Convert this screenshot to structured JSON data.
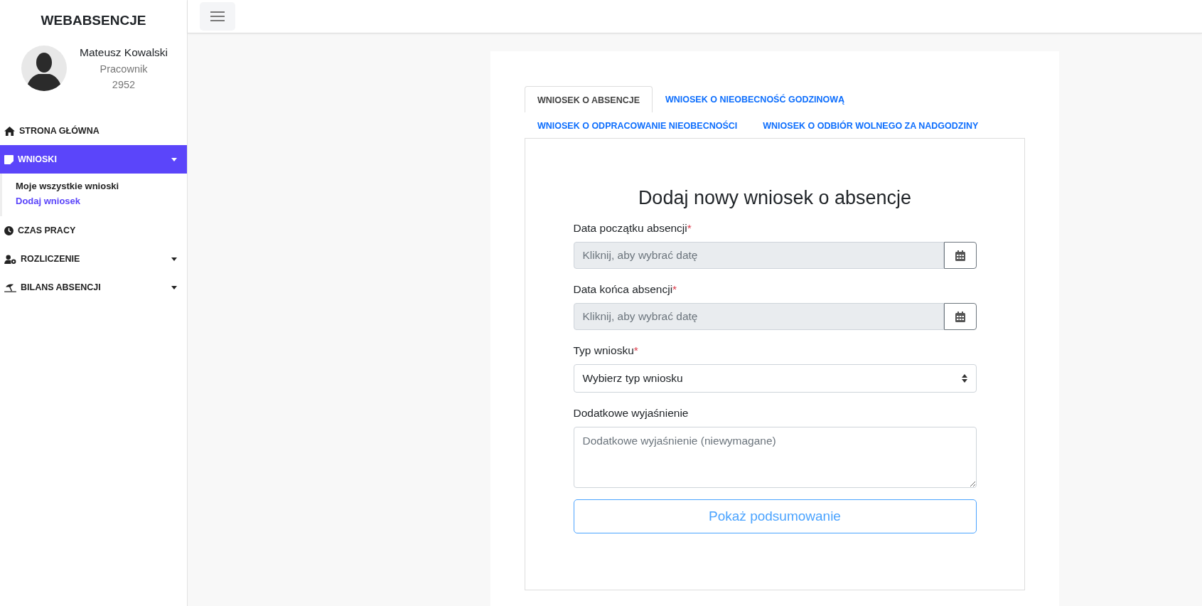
{
  "sidebar": {
    "brand": "WEBABSENCJE",
    "user": {
      "name": "Mateusz Kowalski",
      "role": "Pracownik",
      "number": "2952"
    },
    "items": [
      {
        "label": "STRONA GŁÓWNA",
        "kind": "link",
        "selected": false
      },
      {
        "label": "WNIOSKI",
        "kind": "dropdown",
        "selected": true,
        "children": [
          {
            "label": "Moje wszystkie wnioski",
            "selected": false
          },
          {
            "label": "Dodaj wniosek",
            "selected": true
          }
        ]
      },
      {
        "label": "CZAS PRACY",
        "kind": "link",
        "selected": false
      },
      {
        "label": "ROZLICZENIE",
        "kind": "dropdown",
        "selected": false
      },
      {
        "label": "BILANS ABSENCJI",
        "kind": "dropdown",
        "selected": false
      }
    ]
  },
  "tabs": [
    {
      "label": "WNIOSEK O ABSENCJE",
      "selected": true
    },
    {
      "label": "WNIOSEK O NIEOBECNOŚĆ GODZINOWĄ",
      "selected": false
    },
    {
      "label": "WNIOSEK O ODPRACOWANIE NIEOBECNOŚCI",
      "selected": false
    },
    {
      "label": "WNIOSEK O ODBIÓR WOLNEGO ZA NADGODZINY",
      "selected": false
    }
  ],
  "form": {
    "title": "Dodaj nowy wniosek o absencje",
    "fields": [
      {
        "kind": "date",
        "label": "Data początku absencji",
        "required_mark": "*",
        "placeholder": "Kliknij, aby wybrać datę"
      },
      {
        "kind": "date",
        "label": "Data końca absencji",
        "required_mark": "*",
        "placeholder": "Kliknij, aby wybrać datę"
      },
      {
        "kind": "select",
        "label": "Typ wniosku",
        "required_mark": "*",
        "value": "Wybierz typ wniosku"
      },
      {
        "kind": "textarea",
        "label": "Dodatkowe wyjaśnienie",
        "placeholder": "Dodatkowe wyjaśnienie (niewymagane)"
      }
    ],
    "button": "Pokaż podsumowanie"
  }
}
